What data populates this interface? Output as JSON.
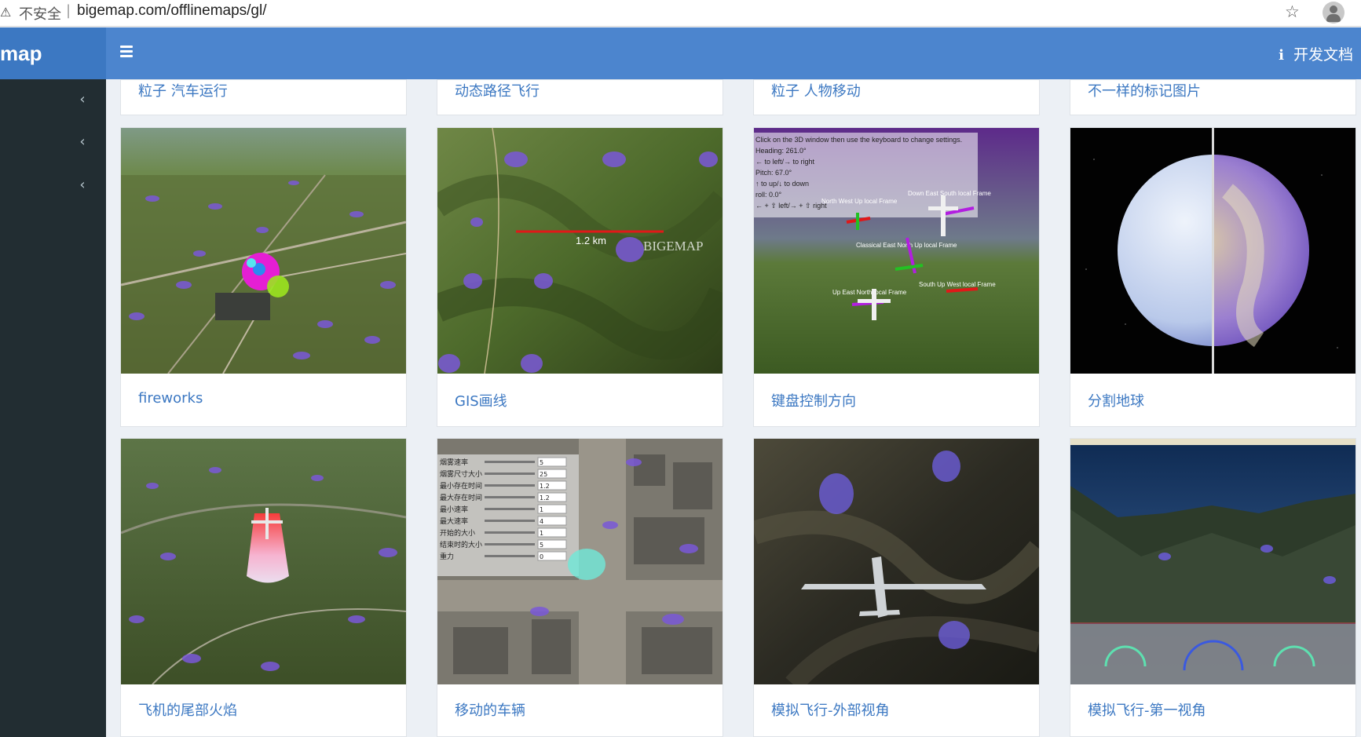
{
  "browser": {
    "insecure_label": "不安全",
    "separator": "|",
    "url": "bigemap.com/offlinemaps/gl/"
  },
  "header": {
    "brand": "map",
    "docs_label": "开发文档"
  },
  "icons": {
    "warning": "warning-icon",
    "star": "star-icon",
    "profile": "profile-icon",
    "menu": "hamburger-menu-icon",
    "info": "info-icon",
    "chevron": "chevron-left-icon"
  },
  "colors": {
    "header_blue": "#4c85ce",
    "brand_blue": "#3c78c2",
    "sidebar_dark": "#222d32",
    "link_blue": "#3c78c2",
    "page_bg": "#ecf0f5"
  },
  "top_row": [
    {
      "title": "粒子 汽车运行"
    },
    {
      "title": "动态路径飞行"
    },
    {
      "title": "粒子 人物移动"
    },
    {
      "title": "不一样的标记图片"
    }
  ],
  "row1": [
    {
      "title": "fireworks"
    },
    {
      "title": "GIS画线"
    },
    {
      "title": "键盘控制方向"
    },
    {
      "title": "分割地球"
    }
  ],
  "row2": [
    {
      "title": "飞机的尾部火焰"
    },
    {
      "title": "移动的车辆"
    },
    {
      "title": "模拟飞行-外部视角"
    },
    {
      "title": "模拟飞行-第一视角"
    }
  ],
  "thumb_text": {
    "gis_scale": "1.2 km",
    "gis_watermark": "BIGEMAP",
    "kb_lines": [
      "Click on the 3D window then use the keyboard to change settings.",
      "Heading: 261.0°",
      "← to left/→ to right",
      "Pitch: 67.0°",
      "↑ to up/↓ to down",
      "roll: 0.0°",
      "← + ⇧ left/→ + ⇧ right"
    ],
    "kb_labels": [
      "North West Up local Frame",
      "Down East South local Frame",
      "Classical East North Up local Frame",
      "South Up West local Frame",
      "Up East North local Frame"
    ],
    "vehicle_params": [
      {
        "label": "烟雾速率",
        "value": "5"
      },
      {
        "label": "烟雾尺寸大小",
        "value": "25"
      },
      {
        "label": "最小存在时间",
        "value": "1.2"
      },
      {
        "label": "最大存在时间",
        "value": "1.2"
      },
      {
        "label": "最小速率",
        "value": "1"
      },
      {
        "label": "最大速率",
        "value": "4"
      },
      {
        "label": "开始的大小",
        "value": "1"
      },
      {
        "label": "结束时的大小",
        "value": "5"
      },
      {
        "label": "重力",
        "value": "0"
      }
    ]
  }
}
